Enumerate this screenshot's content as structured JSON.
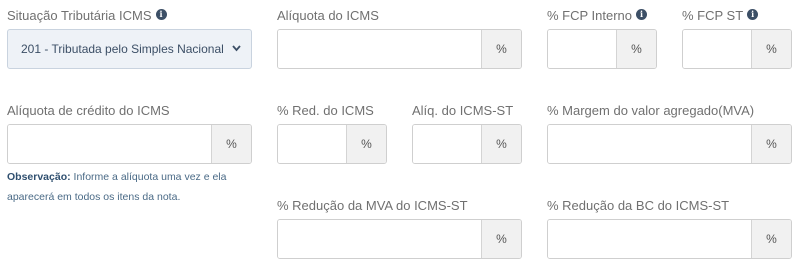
{
  "situacao": {
    "label": "Situação Tributária ICMS",
    "value": "201 - Tributada pelo Simples Nacional"
  },
  "aliquota_icms": {
    "label": "Alíquota do ICMS",
    "unit": "%",
    "value": ""
  },
  "fcp_interno": {
    "label": "% FCP Interno",
    "unit": "%",
    "value": ""
  },
  "fcp_st": {
    "label": "% FCP ST",
    "unit": "%",
    "value": ""
  },
  "aliquota_credito": {
    "label": "Alíquota de crédito do ICMS",
    "unit": "%",
    "value": ""
  },
  "red_icms": {
    "label": "% Red. do ICMS",
    "unit": "%",
    "value": ""
  },
  "aliq_icms_st": {
    "label": "Alíq. do ICMS-ST",
    "unit": "%",
    "value": ""
  },
  "margem_mva": {
    "label": "% Margem do valor agregado(MVA)",
    "unit": "%",
    "value": ""
  },
  "observacao": {
    "title": "Observação:",
    "text": "Informe a alíquota uma vez e ela aparecerá em todos os itens da nota."
  },
  "reducao_mva_st": {
    "label": "% Redução da MVA do ICMS-ST",
    "unit": "%",
    "value": ""
  },
  "reducao_bc_st": {
    "label": "% Redução da BC do ICMS-ST",
    "unit": "%",
    "value": ""
  },
  "info_icon_glyph": "i",
  "colors": {
    "select_bg": "#eef2f7",
    "select_text": "#3c4f66",
    "addon_bg": "#f1f1f1",
    "note_text": "#4a6a86"
  }
}
